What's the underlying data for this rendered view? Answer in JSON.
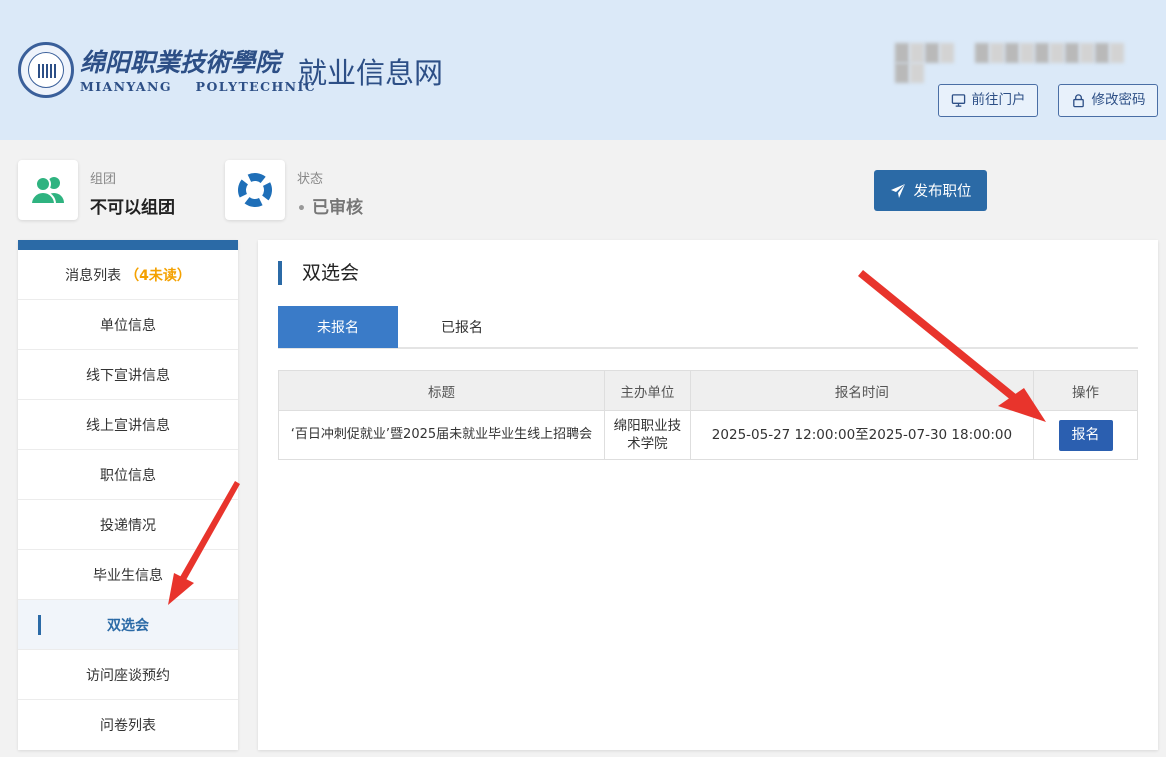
{
  "header": {
    "logo_cn": "绵阳职業技術學院",
    "logo_en": "MIANYANG POLYTECHNIC",
    "site_title": "就业信息网",
    "portal_button": "前往门户",
    "password_button": "修改密码"
  },
  "info": {
    "group_label": "组团",
    "group_value": "不可以组团",
    "status_label": "状态",
    "status_value": "已审核",
    "publish_button": "发布职位"
  },
  "sidebar": {
    "items": [
      {
        "label": "消息列表",
        "badge": "（4未读）"
      },
      {
        "label": "单位信息"
      },
      {
        "label": "线下宣讲信息"
      },
      {
        "label": "线上宣讲信息"
      },
      {
        "label": "职位信息"
      },
      {
        "label": "投递情况"
      },
      {
        "label": "毕业生信息"
      },
      {
        "label": "双选会"
      },
      {
        "label": "访问座谈预约"
      },
      {
        "label": "问卷列表"
      }
    ],
    "active_index": 7
  },
  "main": {
    "title": "双选会",
    "tabs": [
      "未报名",
      "已报名"
    ],
    "table": {
      "columns": [
        "标题",
        "主办单位",
        "报名时间",
        "操作"
      ],
      "rows": [
        {
          "title": "‘百日冲刺促就业’暨2025届未就业毕业生线上招聘会",
          "organizer": "绵阳职业技术学院",
          "time": "2025-05-27 12:00:00至2025-07-30 18:00:00",
          "action": "报名"
        }
      ]
    }
  },
  "colors": {
    "header_bg": "#dbe9f8",
    "brand_blue": "#2b6aa6",
    "annotation_red": "#e8342c",
    "unread_orange": "#f4a100"
  }
}
